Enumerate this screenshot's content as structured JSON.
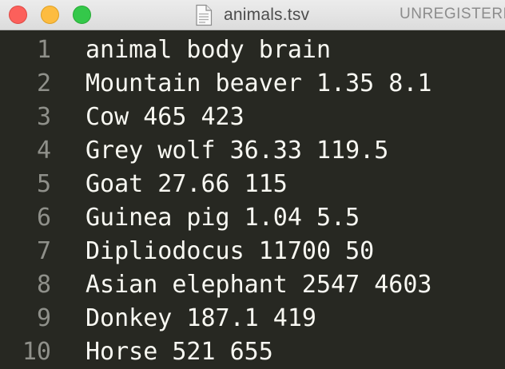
{
  "window": {
    "title": "animals.tsv",
    "status": "UNREGISTERED",
    "colors": {
      "editor_bg": "#272822",
      "text": "#f8f8f2",
      "gutter_text": "#8f908a",
      "close": "#fc605b",
      "minimize": "#fdbc40",
      "zoom": "#34c84a"
    },
    "icons": {
      "file": "file-icon"
    }
  },
  "lines": [
    {
      "number": "1",
      "text": "animal body brain"
    },
    {
      "number": "2",
      "text": "Mountain beaver 1.35 8.1"
    },
    {
      "number": "3",
      "text": "Cow 465 423"
    },
    {
      "number": "4",
      "text": "Grey wolf 36.33 119.5"
    },
    {
      "number": "5",
      "text": "Goat 27.66 115"
    },
    {
      "number": "6",
      "text": "Guinea pig 1.04 5.5"
    },
    {
      "number": "7",
      "text": "Dipliodocus 11700 50"
    },
    {
      "number": "8",
      "text": "Asian elephant 2547 4603"
    },
    {
      "number": "9",
      "text": "Donkey 187.1 419"
    },
    {
      "number": "10",
      "text": "Horse 521 655"
    }
  ]
}
